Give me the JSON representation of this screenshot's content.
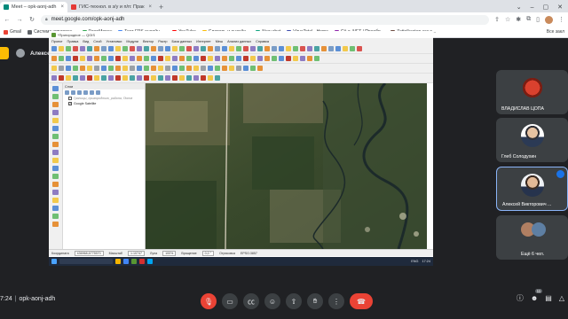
{
  "browser": {
    "tabs": [
      {
        "title": "Meet – opk-aonj-adh",
        "fav_color": "#00897b",
        "active": true
      },
      {
        "title": "ГИС-технол. в з/у и п/п: Прак",
        "fav_color": "#e53935",
        "active": false
      }
    ],
    "url": "meet.google.com/opk-aonj-adh",
    "bookmarks": [
      {
        "label": "Gmail",
        "color": "#ea4335"
      },
      {
        "label": "Система управлен...",
        "color": "#5f6368"
      },
      {
        "label": "DzenMoney",
        "color": "#34a853"
      },
      {
        "label": "Тест FPS онлайн -...",
        "color": "#4285f4"
      },
      {
        "label": "YouTube",
        "color": "#ff0000"
      },
      {
        "label": "Словарь и онлайн...",
        "color": "#fbbc04"
      },
      {
        "label": "New chat",
        "color": "#10a37f"
      },
      {
        "label": "VirusTotal - Home",
        "color": "#3949ab"
      },
      {
        "label": "C# и .NET | Преобр...",
        "color": "#8e24aa"
      },
      {
        "label": "Zettelkasten как о...",
        "color": "#6d4c41"
      }
    ],
    "bookmarks_more": "Все закл"
  },
  "meet": {
    "presenter_label": "Алексей Викторович Мироненко (Показ)",
    "qgis": {
      "title": "*Пригородное — QGIS",
      "menu": [
        "Проект",
        "Правка",
        "Вид",
        "Слой",
        "Установки",
        "Модули",
        "Вектор",
        "Растр",
        "База данных",
        "Интернет",
        "Меш",
        "Анализ данных",
        "Справка"
      ],
      "layers_title": "Слои",
      "layers": [
        {
          "name": "Границы_пригородного_района, Попов",
          "muted": true
        },
        {
          "name": "Google Satellite",
          "muted": false
        }
      ],
      "status": {
        "coord_label": "Координата",
        "coord_value": "436968,6775570",
        "scale_label": "Масштаб",
        "scale_value": "1:10747",
        "magnifier_label": "Лупа",
        "magnifier_value": "100%",
        "rotation_label": "Вращение",
        "rotation_value": "0,0 °",
        "render_label": "Отрисовка",
        "crs": "EPSG:3857"
      },
      "taskbar_time": "17:24",
      "taskbar_lang": "ENG"
    },
    "participants": [
      {
        "name": "ВЛАДИСЛАВ ЦОПА"
      },
      {
        "name": "Глеб Солодухин"
      },
      {
        "name": "Алексей Викторович ..."
      },
      {
        "name": "Ещё 6 чел."
      }
    ],
    "time": "7:24",
    "meeting_code": "opk-aonj-adh",
    "participant_count": "11"
  }
}
